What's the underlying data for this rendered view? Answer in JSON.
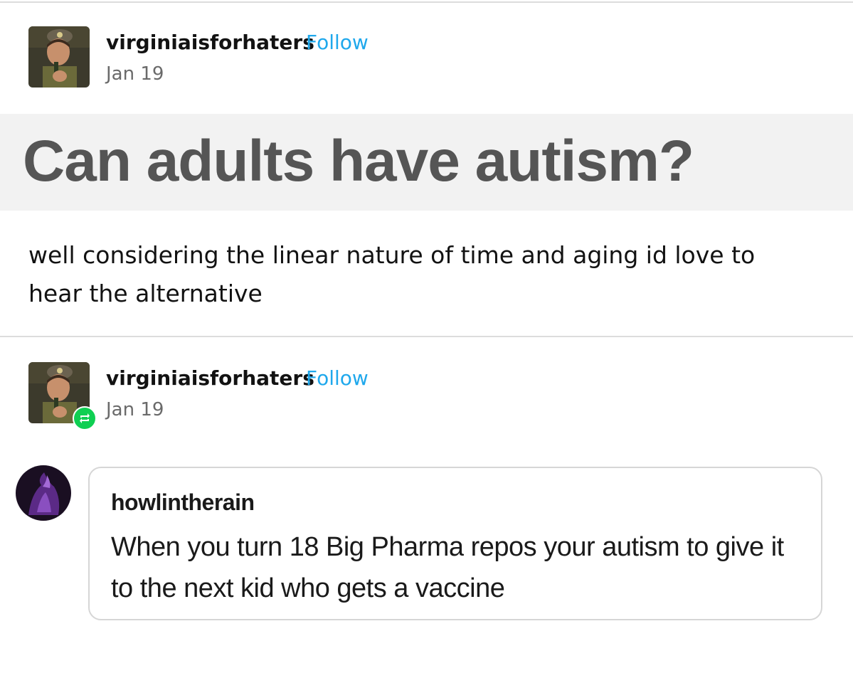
{
  "posts": [
    {
      "username": "virginiaisforhaters",
      "follow_label": "Follow",
      "date": "Jan 19",
      "avatar_icon": "user-avatar-icon",
      "question": "Can adults have autism?",
      "body": "well considering the linear nature of time and aging id love to hear the alternative"
    },
    {
      "username": "virginiaisforhaters",
      "follow_label": "Follow",
      "date": "Jan 19",
      "avatar_icon": "user-avatar-icon",
      "badge_icon": "reblog-icon",
      "quoted": {
        "username": "howlintherain",
        "text": "When you turn 18 Big Pharma repos your autism to give it to the next kid who gets a vaccine",
        "avatar_icon": "purple-avatar-icon"
      }
    }
  ],
  "colors": {
    "follow": "#1fa8ec",
    "reblog_badge": "#0fcf52",
    "question_band": "#f2f2f2",
    "question_text": "#555555"
  }
}
